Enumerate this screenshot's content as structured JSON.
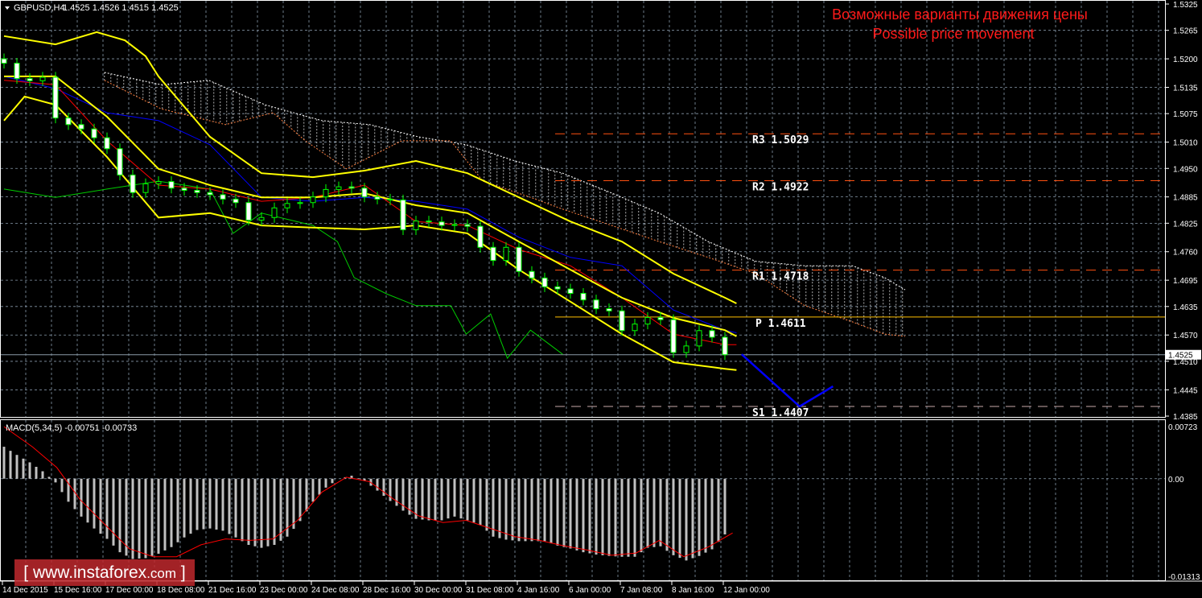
{
  "header": {
    "symbol": "GBPUSD,H4",
    "ohlc": "1.4525 1.4526 1.4515 1.4525"
  },
  "annotation": {
    "line1": "Возможные варианты движения цены",
    "line2": "Possible price movement"
  },
  "macd_label": "MACD(5,34,5) -0.00751 -0.00733",
  "watermark": {
    "open": "[",
    "text": "www.instaforex",
    "suffix": ".com",
    "close": "]"
  },
  "colors": {
    "bull": "#00ff00",
    "bear": "#ffffff",
    "band": "#ffff00",
    "kijun": "#0000ff",
    "tenkan": "#ff0000",
    "chikou": "#00cc00",
    "cloud_a": "#ffffff",
    "cloud_b": "#ff8040",
    "forecast": "#0000ff",
    "pivot_r": "#ff5010",
    "pivot_p": "#ffc000",
    "grid": "#8899aa"
  },
  "chart_data": {
    "type": "candlestick",
    "title": "GBPUSD,H4",
    "ylim": [
      1.4385,
      1.5325
    ],
    "y_ticks": [
      "1.5325",
      "1.5265",
      "1.5200",
      "1.5135",
      "1.5075",
      "1.5010",
      "1.4950",
      "1.4885",
      "1.4825",
      "1.4760",
      "1.4695",
      "1.4635",
      "1.4570",
      "1.4510",
      "1.4445",
      "1.4385"
    ],
    "y_tick_values": [
      1.5325,
      1.5265,
      1.52,
      1.5135,
      1.5075,
      1.501,
      1.495,
      1.4885,
      1.4825,
      1.476,
      1.4695,
      1.4635,
      1.457,
      1.451,
      1.4445,
      1.4385
    ],
    "x_ticks": [
      "14 Dec 2015",
      "15 Dec 16:00",
      "17 Dec 00:00",
      "18 Dec 08:00",
      "21 Dec 16:00",
      "23 Dec 00:00",
      "24 Dec 08:00",
      "28 Dec 16:00",
      "30 Dec 00:00",
      "31 Dec 08:00",
      "4 Jan 16:00",
      "6 Jan 00:00",
      "7 Jan 08:00",
      "8 Jan 16:00",
      "12 Jan 00:00"
    ],
    "first_open": 1.52,
    "closes": [
      1.519,
      1.5155,
      1.515,
      1.5158,
      1.5065,
      1.505,
      1.504,
      1.502,
      1.4995,
      1.4935,
      1.4895,
      1.4915,
      1.492,
      1.4905,
      1.49,
      1.4895,
      1.489,
      1.488,
      1.4872,
      1.4832,
      1.4838,
      1.486,
      1.487,
      1.4872,
      1.4885,
      1.4902,
      1.4908,
      1.4905,
      1.4885,
      1.488,
      1.4878,
      1.481,
      1.483,
      1.4828,
      1.482,
      1.4822,
      1.4818,
      1.477,
      1.474,
      1.477,
      1.4715,
      1.47,
      1.468,
      1.4675,
      1.4665,
      1.465,
      1.463,
      1.4625,
      1.458,
      1.4595,
      1.461,
      1.4605,
      1.453,
      1.4545,
      1.458,
      1.4565,
      1.4525
    ],
    "current_price": {
      "label": "1.4525",
      "value": 1.4525
    },
    "indicators": {
      "band_upper": [
        [
          0,
          1.5252
        ],
        [
          4,
          1.5233
        ],
        [
          7.2,
          1.5261
        ],
        [
          9.4,
          1.5242
        ],
        [
          11,
          1.5206
        ],
        [
          12,
          1.516
        ],
        [
          16,
          1.5022
        ],
        [
          20,
          1.4939
        ],
        [
          24,
          1.493
        ],
        [
          28,
          1.4945
        ],
        [
          32,
          1.4967
        ],
        [
          36,
          1.4939
        ],
        [
          40,
          1.4884
        ],
        [
          44,
          1.4829
        ],
        [
          48,
          1.4783
        ],
        [
          52,
          1.471
        ],
        [
          56,
          1.4655
        ],
        [
          56.9,
          1.4642
        ]
      ],
      "band_middle": [
        [
          0,
          1.516
        ],
        [
          4,
          1.516
        ],
        [
          8,
          1.5068
        ],
        [
          12,
          1.4949
        ],
        [
          16,
          1.4912
        ],
        [
          20,
          1.4884
        ],
        [
          24,
          1.4884
        ],
        [
          28,
          1.4893
        ],
        [
          32,
          1.4866
        ],
        [
          36,
          1.4848
        ],
        [
          40,
          1.4783
        ],
        [
          44,
          1.4719
        ],
        [
          48,
          1.4655
        ],
        [
          52,
          1.4609
        ],
        [
          56,
          1.4581
        ],
        [
          56.9,
          1.4567
        ]
      ],
      "band_lower": [
        [
          0,
          1.5059
        ],
        [
          1.6,
          1.5114
        ],
        [
          4,
          1.5095
        ],
        [
          8,
          1.4976
        ],
        [
          12,
          1.4838
        ],
        [
          16,
          1.4848
        ],
        [
          20,
          1.482
        ],
        [
          24,
          1.4815
        ],
        [
          28,
          1.4811
        ],
        [
          32,
          1.482
        ],
        [
          36,
          1.4802
        ],
        [
          40,
          1.4719
        ],
        [
          44,
          1.4646
        ],
        [
          48,
          1.4572
        ],
        [
          52,
          1.4508
        ],
        [
          56,
          1.4493
        ],
        [
          56.9,
          1.449
        ]
      ],
      "kijun": [
        [
          0,
          1.516
        ],
        [
          4,
          1.5132
        ],
        [
          8,
          1.5077
        ],
        [
          12,
          1.5059
        ],
        [
          16,
          1.5004
        ],
        [
          20,
          1.4884
        ],
        [
          24,
          1.4875
        ],
        [
          28,
          1.4884
        ],
        [
          32,
          1.4875
        ],
        [
          36,
          1.4857
        ],
        [
          40,
          1.4793
        ],
        [
          44,
          1.4747
        ],
        [
          48,
          1.4728
        ],
        [
          52,
          1.4627
        ],
        [
          56,
          1.4581
        ],
        [
          56.9,
          1.4575
        ]
      ],
      "tenkan": [
        [
          0,
          1.5151
        ],
        [
          4,
          1.5141
        ],
        [
          8,
          1.5013
        ],
        [
          12,
          1.4912
        ],
        [
          16,
          1.4903
        ],
        [
          20,
          1.4875
        ],
        [
          24,
          1.4884
        ],
        [
          28,
          1.4912
        ],
        [
          32,
          1.4829
        ],
        [
          36,
          1.482
        ],
        [
          40,
          1.4765
        ],
        [
          44,
          1.4728
        ],
        [
          48,
          1.4655
        ],
        [
          52,
          1.4572
        ],
        [
          56,
          1.4548
        ],
        [
          56.9,
          1.4548
        ]
      ],
      "chikou": [
        [
          0,
          1.4903
        ],
        [
          4,
          1.4884
        ],
        [
          8,
          1.4903
        ],
        [
          12,
          1.4921
        ],
        [
          16,
          1.4903
        ],
        [
          17.8,
          1.4802
        ],
        [
          20,
          1.4848
        ],
        [
          24,
          1.482
        ],
        [
          25.9,
          1.4783
        ],
        [
          27.2,
          1.4701
        ],
        [
          29.7,
          1.4664
        ],
        [
          32,
          1.4637
        ],
        [
          34.7,
          1.4637
        ],
        [
          35.9,
          1.4572
        ],
        [
          37.8,
          1.4618
        ],
        [
          39.1,
          1.4517
        ],
        [
          40.9,
          1.4581
        ],
        [
          43.4,
          1.4526
        ]
      ],
      "cloud_span_a": [
        [
          7.8,
          1.5169
        ],
        [
          12.2,
          1.5141
        ],
        [
          15.9,
          1.5151
        ],
        [
          20.3,
          1.5095
        ],
        [
          24.7,
          1.5059
        ],
        [
          28.4,
          1.505
        ],
        [
          32.2,
          1.5022
        ],
        [
          35.9,
          1.5004
        ],
        [
          39.7,
          1.4967
        ],
        [
          43.4,
          1.4939
        ],
        [
          47.2,
          1.4894
        ],
        [
          50.9,
          1.4848
        ],
        [
          54.7,
          1.4783
        ],
        [
          58.4,
          1.4738
        ],
        [
          62.2,
          1.4728
        ],
        [
          65.9,
          1.4728
        ],
        [
          68.4,
          1.4701
        ],
        [
          70,
          1.4673
        ]
      ],
      "cloud_span_b": [
        [
          7.8,
          1.5151
        ],
        [
          12.2,
          1.5086
        ],
        [
          17.2,
          1.505
        ],
        [
          20.9,
          1.5077
        ],
        [
          23.4,
          1.5013
        ],
        [
          26.6,
          1.4949
        ],
        [
          30.9,
          1.5013
        ],
        [
          34.7,
          1.5013
        ],
        [
          37.2,
          1.4921
        ],
        [
          40.9,
          1.4884
        ],
        [
          43.4,
          1.4857
        ],
        [
          47.2,
          1.482
        ],
        [
          50.9,
          1.4783
        ],
        [
          54.7,
          1.4747
        ],
        [
          58.4,
          1.471
        ],
        [
          62.2,
          1.4637
        ],
        [
          65.9,
          1.46
        ],
        [
          68.4,
          1.4572
        ],
        [
          70,
          1.4567
        ]
      ],
      "forecast": [
        [
          57.3,
          1.4526
        ],
        [
          61.8,
          1.4407
        ],
        [
          64.4,
          1.4453
        ]
      ]
    },
    "pivots": [
      {
        "name": "R3",
        "label": "R3  1.5029",
        "value": 1.5029,
        "style": "r"
      },
      {
        "name": "R2",
        "label": "R2  1.4922",
        "value": 1.4922,
        "style": "r"
      },
      {
        "name": "R1",
        "label": "R1  1.4718",
        "value": 1.4718,
        "style": "r"
      },
      {
        "name": "P",
        "label": "P  1.4611",
        "value": 1.4611,
        "style": "p"
      },
      {
        "name": "S1",
        "label": "S1  1.4407",
        "value": 1.4407,
        "style": "s"
      }
    ],
    "macd": {
      "ylim": [
        -0.01313,
        0.00723
      ],
      "y_ticks": [
        "0.00723",
        "0.00",
        "-0.01313"
      ],
      "y_tick_values": [
        0.00723,
        0,
        -0.01313
      ],
      "histogram": [
        0.0043,
        0.0032,
        0.0022,
        0.001,
        -0.0005,
        -0.0031,
        -0.0051,
        -0.0067,
        -0.0081,
        -0.0099,
        -0.0108,
        -0.0107,
        -0.0101,
        -0.0092,
        -0.0079,
        -0.0069,
        -0.0067,
        -0.007,
        -0.0079,
        -0.0089,
        -0.0093,
        -0.0089,
        -0.0078,
        -0.0057,
        -0.0031,
        -0.0012,
        0.0,
        0.0004,
        -0.0003,
        -0.0016,
        -0.003,
        -0.0043,
        -0.0054,
        -0.0056,
        -0.0056,
        -0.0051,
        -0.0056,
        -0.0062,
        -0.0078,
        -0.0082,
        -0.0084,
        -0.0084,
        -0.0084,
        -0.009,
        -0.0094,
        -0.0099,
        -0.0102,
        -0.0104,
        -0.0105,
        -0.0105,
        -0.0093,
        -0.0091,
        -0.0103,
        -0.011,
        -0.0104,
        -0.0095,
        -0.0075
      ],
      "signal": [
        [
          0,
          0.007
        ],
        [
          2.2,
          0.0043
        ],
        [
          4.1,
          0.0015
        ],
        [
          5.9,
          -0.0028
        ],
        [
          7.8,
          -0.0061
        ],
        [
          9.7,
          -0.0094
        ],
        [
          11.6,
          -0.0105
        ],
        [
          13.4,
          -0.0105
        ],
        [
          15.3,
          -0.0089
        ],
        [
          17.2,
          -0.0081
        ],
        [
          19.1,
          -0.0083
        ],
        [
          20.9,
          -0.0081
        ],
        [
          22.8,
          -0.0056
        ],
        [
          24.7,
          -0.0018
        ],
        [
          26.6,
          0.0002
        ],
        [
          28.4,
          -0.0004
        ],
        [
          30.3,
          -0.0028
        ],
        [
          32.2,
          -0.005
        ],
        [
          34.1,
          -0.0059
        ],
        [
          35.9,
          -0.0056
        ],
        [
          37.8,
          -0.0067
        ],
        [
          39.7,
          -0.0078
        ],
        [
          41.6,
          -0.0083
        ],
        [
          43.4,
          -0.009
        ],
        [
          45.3,
          -0.0096
        ],
        [
          47.2,
          -0.0103
        ],
        [
          49.1,
          -0.01
        ],
        [
          50.9,
          -0.0083
        ],
        [
          52.8,
          -0.0105
        ],
        [
          54.7,
          -0.0092
        ],
        [
          56.6,
          -0.0073
        ]
      ]
    }
  }
}
